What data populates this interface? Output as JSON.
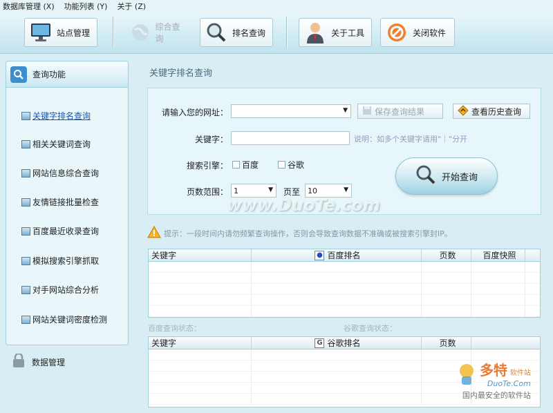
{
  "menu": {
    "items": [
      "数据库管理 (X)",
      "功能列表 (Y)",
      "关于 (Z)"
    ]
  },
  "toolbar": {
    "site_manage": "站点管理",
    "comprehensive_query": "综合查询",
    "rank_query": "排名查询",
    "about_tool": "关于工具",
    "close_software": "关闭软件"
  },
  "sidebar": {
    "title": "查询功能",
    "items": [
      {
        "label": "关键字排名查询"
      },
      {
        "label": "相关关键词查询"
      },
      {
        "label": "网站信息综合查询"
      },
      {
        "label": "友情链接批量检查"
      },
      {
        "label": "百度最近收录查询"
      },
      {
        "label": "模拟搜索引擎抓取"
      },
      {
        "label": "对手网站综合分析"
      },
      {
        "label": "网站关键词密度检测"
      }
    ],
    "data_manage": "数据管理"
  },
  "main": {
    "title": "关键字排名查询",
    "url_label": "请输入您的网址：",
    "url_value": "",
    "save_result": "保存查询结果",
    "view_history": "查看历史查询",
    "keyword_label": "关键字：",
    "keyword_hint": "说明：如多个关键字请用\"｜\"分开",
    "engine_label": "搜索引擎：",
    "engine_baidu": "百度",
    "engine_google": "谷歌",
    "page_range_label": "页数范围：",
    "page_from": "1",
    "page_to_label": "页至",
    "page_to": "10",
    "start_button": "开始查询",
    "warning": "提示：一段时间内请勿频繁查询操作，否则会导致查询数据不准确或被搜索引擎封IP。"
  },
  "baidu_table": {
    "columns": [
      "关键字",
      "百度排名",
      "页数",
      "百度快照"
    ]
  },
  "status": {
    "baidu": "百度查询状态：",
    "google": "谷歌查询状态："
  },
  "google_table": {
    "columns": [
      "关键字",
      "谷歌排名",
      "页数"
    ]
  },
  "watermark": {
    "center": "www.DuoTe.com",
    "logo_name": "多特",
    "logo_sub": "软件站",
    "logo_url": "DuoTe.Com",
    "slogan": "国内最安全的软件站"
  },
  "colors": {
    "accent": "#1a55b8",
    "background": "#d8eef4"
  }
}
